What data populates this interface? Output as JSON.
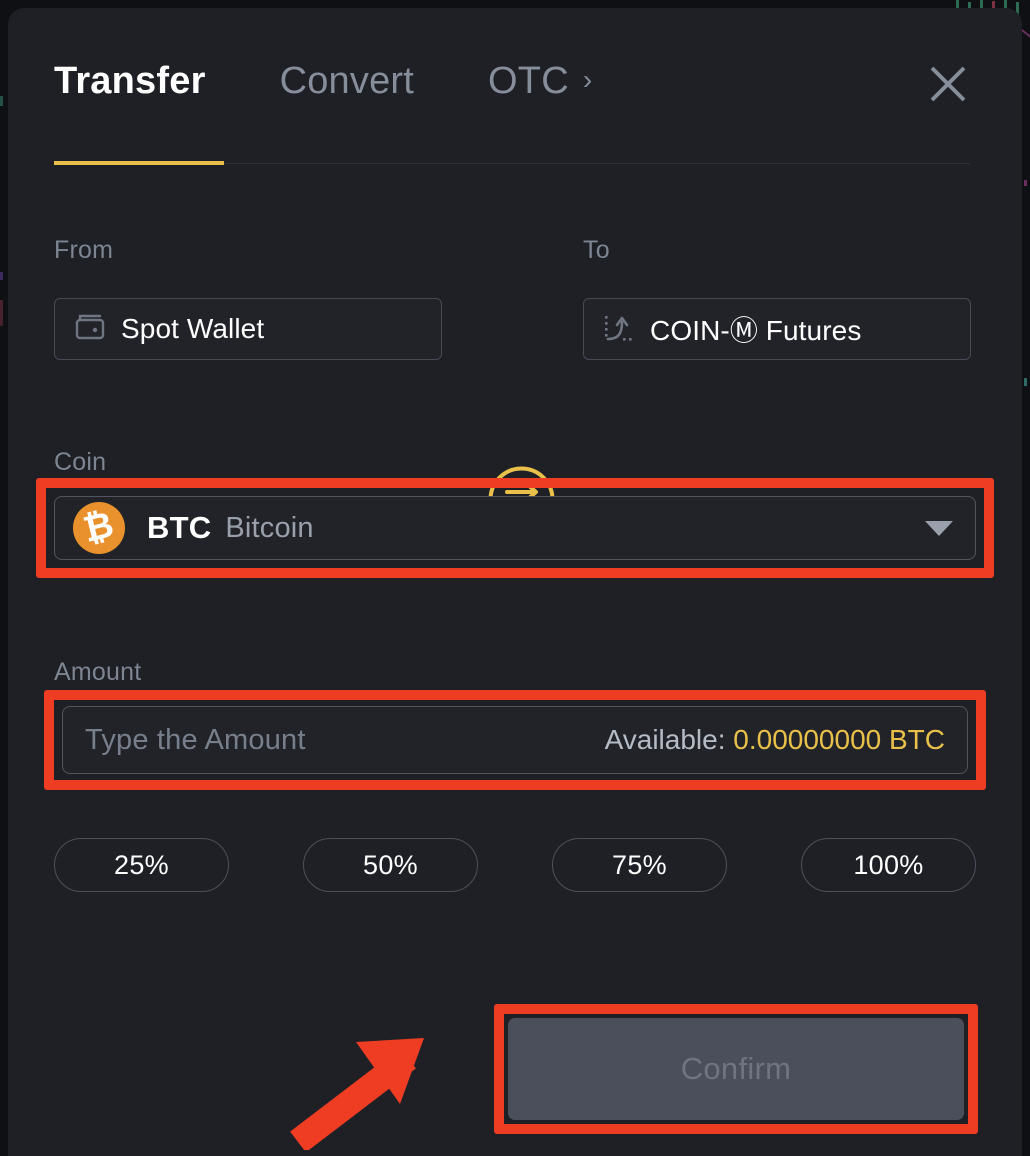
{
  "colors": {
    "modal_bg": "#1e2026",
    "accent_yellow": "#e9c049",
    "annotation_red": "#ef3d23",
    "btc_orange": "#e8912d",
    "text_primary": "#ffffff",
    "text_muted": "#7d8492",
    "confirm_disabled_bg": "#4b4f5b",
    "confirm_disabled_text": "#6f747e"
  },
  "header": {
    "tabs": [
      {
        "label": "Transfer",
        "active": true
      },
      {
        "label": "Convert",
        "active": false
      },
      {
        "label": "OTC",
        "active": false,
        "chevron": "›"
      }
    ],
    "close_icon": "close-icon"
  },
  "transfer": {
    "from": {
      "label": "From",
      "value": "Spot Wallet",
      "icon": "wallet-icon"
    },
    "to": {
      "label": "To",
      "value": "COIN-Ⓜ Futures",
      "icon": "futures-trend-icon"
    },
    "swap_icon": "swap-arrows-icon"
  },
  "coin": {
    "label": "Coin",
    "symbol": "BTC",
    "name": "Bitcoin",
    "logo_glyph": "₿",
    "caret_icon": "chevron-down-icon",
    "highlighted": true
  },
  "amount": {
    "label": "Amount",
    "value": "",
    "placeholder": "Type the Amount",
    "available_label": "Available:",
    "available_value": "0.00000000 BTC",
    "highlighted": true
  },
  "percent_buttons": [
    {
      "label": "25%"
    },
    {
      "label": "50%"
    },
    {
      "label": "75%"
    },
    {
      "label": "100%"
    }
  ],
  "confirm": {
    "label": "Confirm",
    "disabled": true,
    "highlighted": true,
    "annotation_arrow": "arrow-pointing-to-confirm"
  }
}
